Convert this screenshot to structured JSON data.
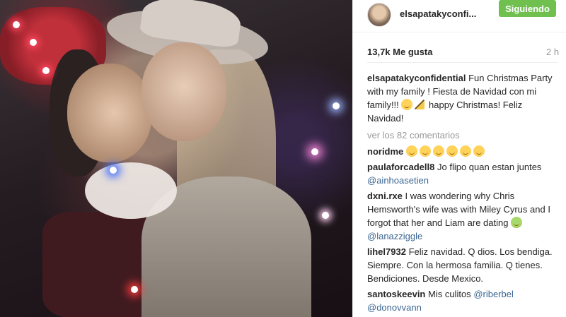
{
  "post": {
    "username": "elsapatakyconfi...",
    "follow_label": "Siguiendo",
    "likes": "13,7k Me gusta",
    "age": "2 h",
    "caption_user": "elsapatakyconfidential",
    "caption_text_1": "Fun Christmas Party with my family ! Fiesta de Navidad con mi family!!!",
    "caption_text_2": "happy Christmas! Feliz Navidad!",
    "view_all": "ver los 82 comentarios"
  },
  "comments": [
    {
      "user": "noridme",
      "text": "",
      "mention": ""
    },
    {
      "user": "paulaforcadell8",
      "text": "Jo flipo quan estan juntes",
      "mention": "@ainhoasetien"
    },
    {
      "user": "dxni.rxe",
      "text": "I was wondering why Chris Hemsworth's wife was with Miley Cyrus and I forgot that her and Liam are dating",
      "mention": "@lanazziggle"
    },
    {
      "user": "lihel7932",
      "text": "Feliz navidad. Q dios. Los bendiga. Siempre. Con la hermosa familia. Q tienes. Bendiciones. Desde Mexico.",
      "mention": ""
    },
    {
      "user": "santoskeevin",
      "text": "Mis culitos",
      "mention": "@riberbel"
    },
    {
      "user": "",
      "text": "",
      "mention": "@donovvann"
    }
  ],
  "icons": {
    "laugh_emoji": "laughing-face-emoji",
    "party_emoji": "party-popper-emoji",
    "green_emoji": "green-grinning-emoji"
  },
  "colors": {
    "follow_bg": "#70c050",
    "mention": "#3b6692",
    "muted": "#999999"
  }
}
